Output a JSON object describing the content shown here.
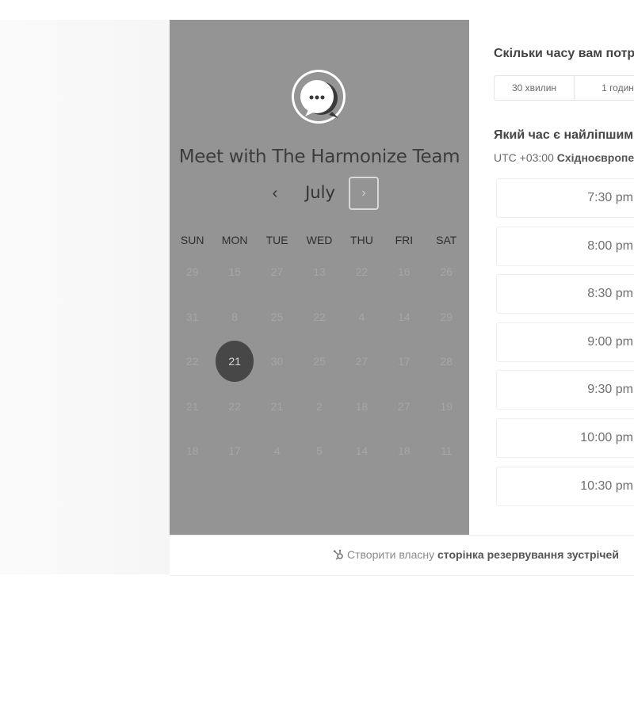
{
  "calendar": {
    "title": "Meet with The Harmonize Team",
    "month": "July",
    "prev_icon": "‹",
    "next_icon": "›",
    "weekdays": [
      "SUN",
      "MON",
      "TUE",
      "WED",
      "THU",
      "FRI",
      "SAT"
    ],
    "weeks": [
      [
        "29",
        "15",
        "27",
        "13",
        "22",
        "16",
        "26"
      ],
      [
        "31",
        "8",
        "25",
        "22",
        "4",
        "14",
        "29"
      ],
      [
        "22",
        "21",
        "30",
        "25",
        "27",
        "17",
        "28"
      ],
      [
        "21",
        "22",
        "21",
        "2",
        "18",
        "27",
        "19"
      ],
      [
        "18",
        "17",
        "4",
        "5",
        "14",
        "18",
        "11"
      ]
    ],
    "selected": "21",
    "colors": {
      "panel": "#949494",
      "selected_bg": "#474747"
    }
  },
  "booking": {
    "duration_question": "Скільки часу вам потріб",
    "duration_options": [
      "30 хвилин",
      "1 годин"
    ],
    "time_question": "Який час є найліпшим д",
    "timezone_offset": "UTC +03:00",
    "timezone_name": "Східноєвропей",
    "time_slots": [
      "7:30 pm",
      "8:00 pm",
      "8:30 pm",
      "9:00 pm",
      "9:30 pm",
      "10:00 pm",
      "10:30 pm"
    ]
  },
  "footer": {
    "icon": "hubspot-sprocket-icon",
    "prefix": "Створити власну",
    "link": "сторінка резервування зустрічей"
  }
}
